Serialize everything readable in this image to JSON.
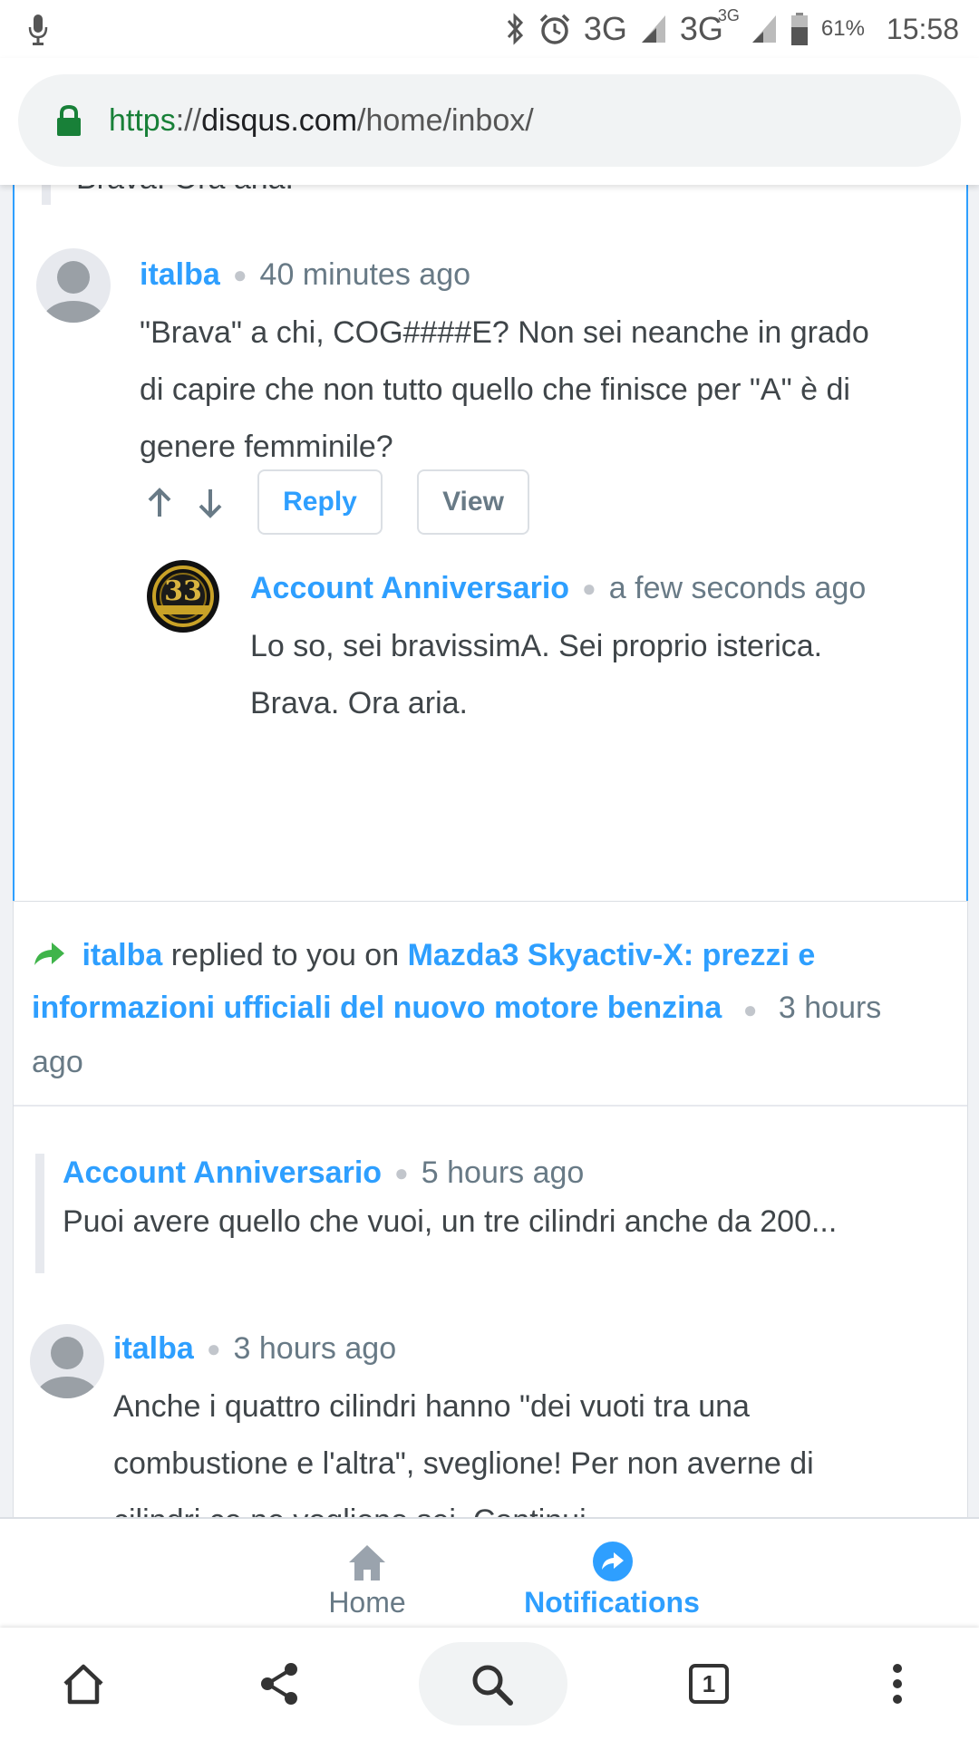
{
  "status_bar": {
    "network_1": "3G",
    "network_2": "3G",
    "network_2_sup": "3G",
    "battery": "61%",
    "time": "15:58"
  },
  "url_bar": {
    "scheme": "https",
    "separator": "://",
    "host": "disqus.com",
    "path": "/home/inbox/"
  },
  "thread1": {
    "quoted_tail": "Brava. Ora aria.",
    "comment": {
      "author": "italba",
      "time": "40 minutes ago",
      "text_line1": "\"Brava\" a chi, COG####E? Non sei neanche in grado",
      "text_line2": "di capire che non tutto quello che finisce per \"A\" è di",
      "text_line3": "genere femminile?"
    },
    "actions": {
      "reply_label": "Reply",
      "view_label": "View"
    },
    "reply": {
      "author": "Account Anniversario",
      "time": "a few seconds ago",
      "avatar_text": "33",
      "text_line1": "Lo so, sei bravissimA. Sei proprio isterica.",
      "text_line2": "Brava. Ora aria."
    }
  },
  "notification2": {
    "actor": "italba",
    "verb": "replied to you on",
    "title_line1": "Mazda3 Skyactiv-X: prezzi e",
    "title_line2": "informazioni ufficiali del nuovo motore benzina",
    "time_part1": "3 hours",
    "time_part2": "ago",
    "quoted": {
      "author": "Account Anniversario",
      "time": "5 hours ago",
      "text": "Puoi avere quello che vuoi, un tre cilindri anche da 200..."
    },
    "comment": {
      "author": "italba",
      "time": "3 hours ago",
      "text_line1": "Anche i quattro cilindri hanno \"dei vuoti tra una",
      "text_line2": "combustione e l'altra\", sveglione! Per non averne di",
      "text_line3": "cilindri ce ne vogliono sei. Continui..."
    }
  },
  "app_nav": {
    "home_label": "Home",
    "notifications_label": "Notifications"
  },
  "browser_toolbar": {
    "tab_count": "1"
  },
  "colors": {
    "accent": "#2e9fff",
    "text": "#3f4549",
    "meta": "#687a86",
    "secure_green": "#188038",
    "reply_arrow": "#3fb44a"
  }
}
